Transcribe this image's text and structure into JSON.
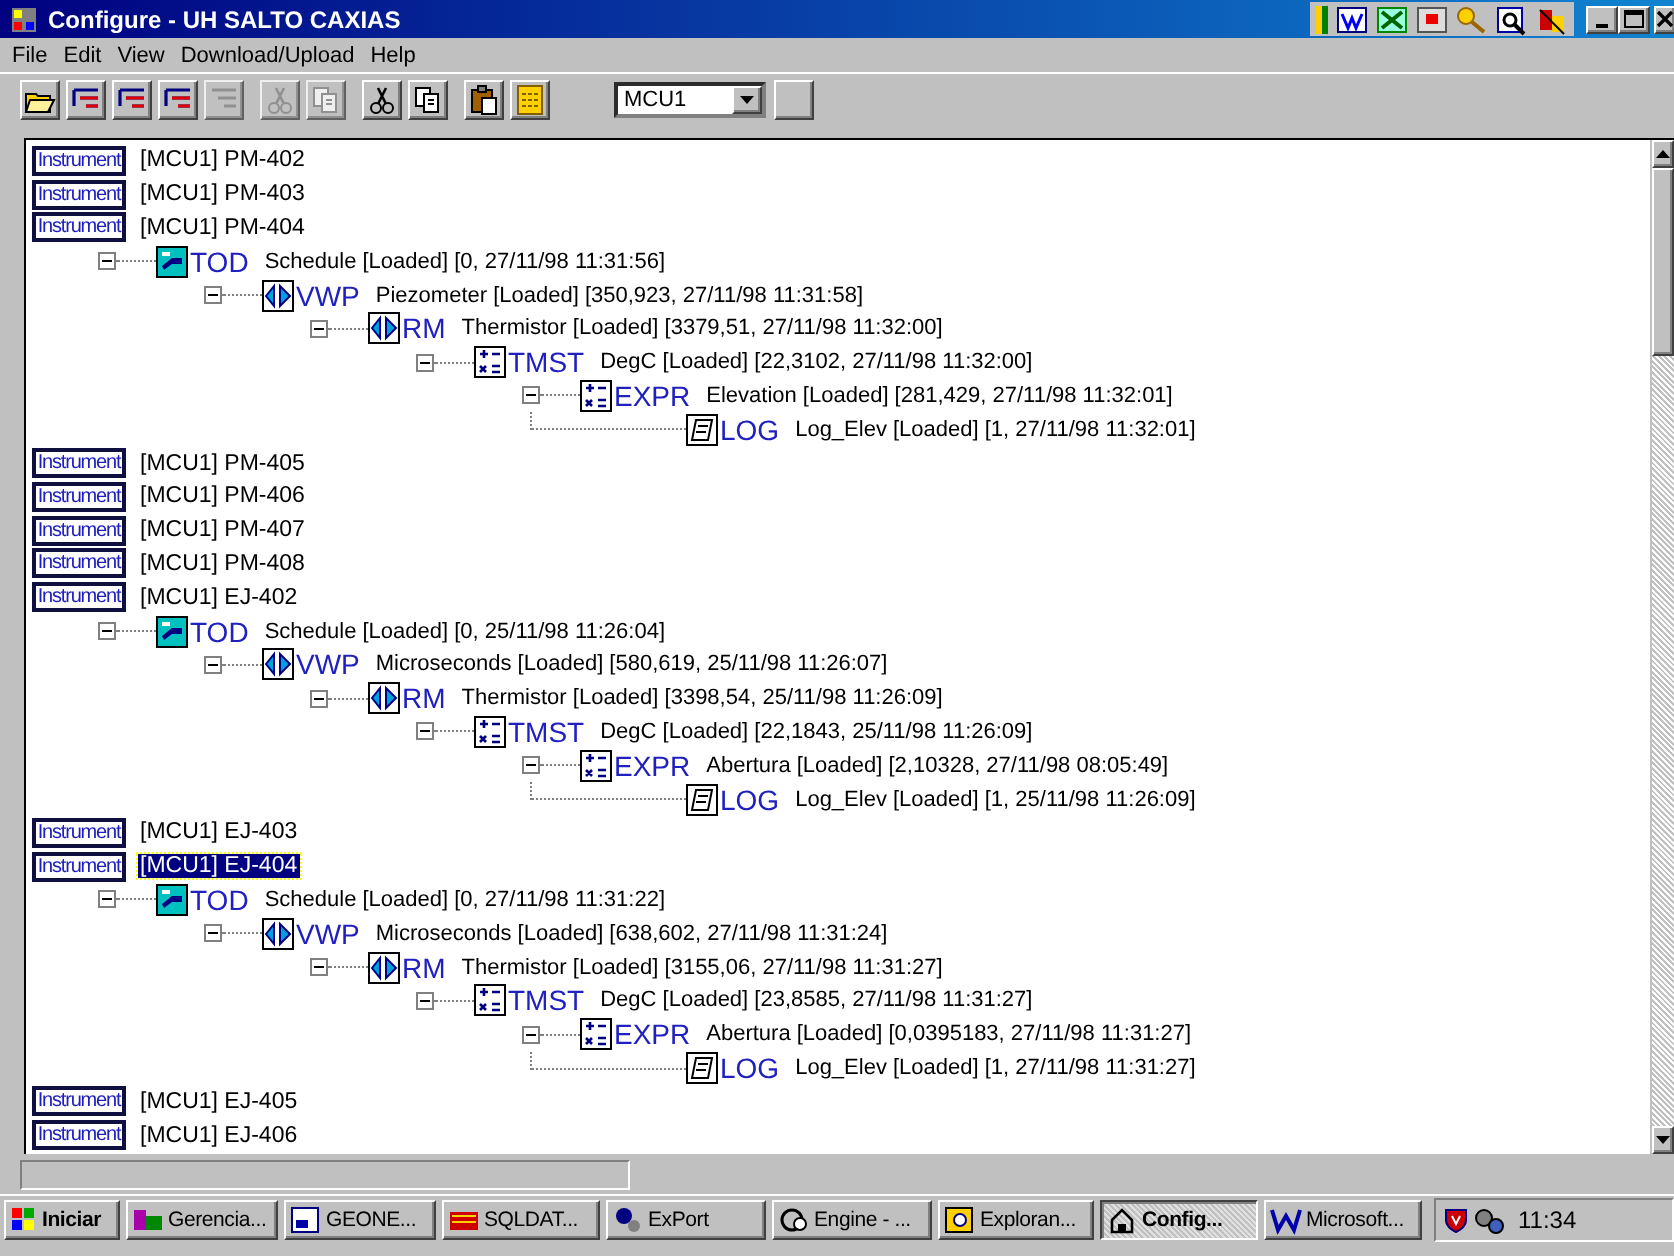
{
  "window": {
    "title": "Configure - UH SALTO CAXIAS"
  },
  "menu": [
    "File",
    "Edit",
    "View",
    "Download/Upload",
    "Help"
  ],
  "toolbar": {
    "groups": [
      [
        {
          "kind": "open",
          "disabled": false
        },
        {
          "kind": "tree-red",
          "disabled": false
        },
        {
          "kind": "tree-red",
          "disabled": false
        },
        {
          "kind": "tree-red",
          "disabled": false
        },
        {
          "kind": "tree-grey",
          "disabled": true
        }
      ],
      [
        {
          "kind": "cut",
          "disabled": true
        },
        {
          "kind": "copy",
          "disabled": true
        }
      ],
      [
        {
          "kind": "cut",
          "disabled": false
        },
        {
          "kind": "copy",
          "disabled": false
        }
      ],
      [
        {
          "kind": "paste",
          "disabled": false
        },
        {
          "kind": "panel",
          "disabled": false
        }
      ]
    ],
    "device_select": {
      "value": "MCU1"
    }
  },
  "tree": [
    {
      "badge": "Instrument",
      "label": "[MCU1] PM-402",
      "selected": false
    },
    {
      "badge": "Instrument",
      "label": "[MCU1] PM-403",
      "selected": false
    },
    {
      "badge": "Instrument",
      "label": "[MCU1] PM-404",
      "selected": false,
      "children": [
        {
          "kind": "tod",
          "type": "TOD",
          "text": "Schedule [Loaded] [0, 27/11/98 11:31:56]",
          "expanded": true,
          "children": [
            {
              "kind": "vwp",
              "type": "VWP",
              "text": "Piezometer [Loaded] [350,923, 27/11/98 11:31:58]",
              "expanded": true,
              "children": [
                {
                  "kind": "vwp",
                  "type": "RM",
                  "text": "Thermistor [Loaded] [3379,51, 27/11/98 11:32:00]",
                  "expanded": true,
                  "children": [
                    {
                      "kind": "calc",
                      "type": "TMST",
                      "text": "DegC [Loaded] [22,3102, 27/11/98 11:32:00]",
                      "expanded": true,
                      "children": [
                        {
                          "kind": "calc",
                          "type": "EXPR",
                          "text": "Elevation [Loaded] [281,429, 27/11/98 11:32:01]",
                          "expanded": true,
                          "children": [
                            {
                              "kind": "log",
                              "type": "LOG",
                              "text": "Log_Elev [Loaded] [1, 27/11/98 11:32:01]"
                            }
                          ]
                        }
                      ]
                    }
                  ]
                }
              ]
            }
          ]
        }
      ]
    },
    {
      "badge": "Instrument",
      "label": "[MCU1] PM-405",
      "selected": false
    },
    {
      "badge": "Instrument",
      "label": "[MCU1] PM-406",
      "selected": false
    },
    {
      "badge": "Instrument",
      "label": "[MCU1] PM-407",
      "selected": false
    },
    {
      "badge": "Instrument",
      "label": "[MCU1] PM-408",
      "selected": false
    },
    {
      "badge": "Instrument",
      "label": "[MCU1] EJ-402",
      "selected": false,
      "children": [
        {
          "kind": "tod",
          "type": "TOD",
          "text": "Schedule [Loaded] [0, 25/11/98 11:26:04]",
          "expanded": true,
          "children": [
            {
              "kind": "vwp",
              "type": "VWP",
              "text": "Microseconds [Loaded] [580,619, 25/11/98 11:26:07]",
              "expanded": true,
              "children": [
                {
                  "kind": "vwp",
                  "type": "RM",
                  "text": "Thermistor [Loaded] [3398,54, 25/11/98 11:26:09]",
                  "expanded": true,
                  "children": [
                    {
                      "kind": "calc",
                      "type": "TMST",
                      "text": "DegC [Loaded] [22,1843, 25/11/98 11:26:09]",
                      "expanded": true,
                      "children": [
                        {
                          "kind": "calc",
                          "type": "EXPR",
                          "text": "Abertura [Loaded] [2,10328, 27/11/98 08:05:49]",
                          "expanded": true,
                          "children": [
                            {
                              "kind": "log",
                              "type": "LOG",
                              "text": "Log_Elev [Loaded] [1, 25/11/98 11:26:09]"
                            }
                          ]
                        }
                      ]
                    }
                  ]
                }
              ]
            }
          ]
        }
      ]
    },
    {
      "badge": "Instrument",
      "label": "[MCU1] EJ-403",
      "selected": false
    },
    {
      "badge": "Instrument",
      "label": "[MCU1] EJ-404",
      "selected": true,
      "children": [
        {
          "kind": "tod",
          "type": "TOD",
          "text": "Schedule [Loaded] [0, 27/11/98 11:31:22]",
          "expanded": true,
          "children": [
            {
              "kind": "vwp",
              "type": "VWP",
              "text": "Microseconds [Loaded] [638,602, 27/11/98 11:31:24]",
              "expanded": true,
              "children": [
                {
                  "kind": "vwp",
                  "type": "RM",
                  "text": "Thermistor [Loaded] [3155,06, 27/11/98 11:31:27]",
                  "expanded": true,
                  "children": [
                    {
                      "kind": "calc",
                      "type": "TMST",
                      "text": "DegC [Loaded] [23,8585, 27/11/98 11:31:27]",
                      "expanded": true,
                      "children": [
                        {
                          "kind": "calc",
                          "type": "EXPR",
                          "text": "Abertura [Loaded] [0,0395183, 27/11/98 11:31:27]",
                          "expanded": true,
                          "children": [
                            {
                              "kind": "log",
                              "type": "LOG",
                              "text": "Log_Elev [Loaded] [1, 27/11/98 11:31:27]"
                            }
                          ]
                        }
                      ]
                    }
                  ]
                }
              ]
            }
          ]
        }
      ]
    },
    {
      "badge": "Instrument",
      "label": "[MCU1] EJ-405",
      "selected": false
    },
    {
      "badge": "Instrument",
      "label": "[MCU1] EJ-406",
      "selected": false
    }
  ],
  "taskbar": {
    "start": "Iniciar",
    "tasks": [
      {
        "label": "Gerencia...",
        "selected": false
      },
      {
        "label": "GEONE...",
        "selected": false
      },
      {
        "label": "SQLDAT...",
        "selected": false
      },
      {
        "label": "ExPort",
        "selected": false
      },
      {
        "label": "Engine - ...",
        "selected": false
      },
      {
        "label": "Exploran...",
        "selected": false
      },
      {
        "label": "Config...",
        "selected": true
      },
      {
        "label": "Microsoft...",
        "selected": false
      }
    ],
    "clock": "11:34"
  }
}
